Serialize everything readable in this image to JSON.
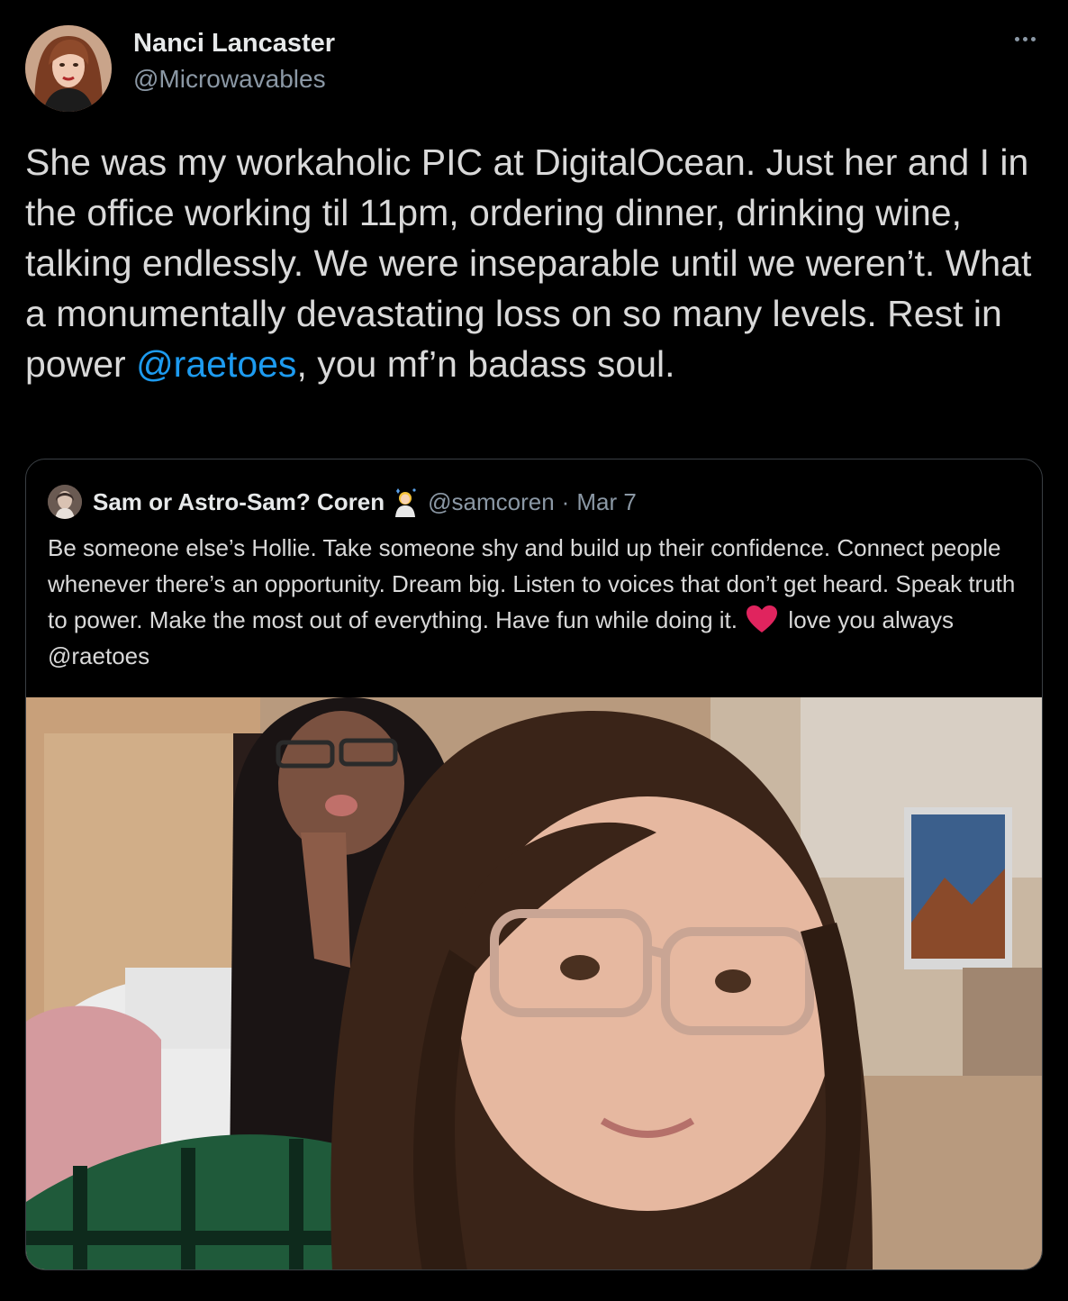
{
  "author": {
    "name": "Nanci Lancaster",
    "handle": "@Microwavables"
  },
  "menu": {
    "icon": "more-horizontal-icon"
  },
  "tweet": {
    "text_before": "She was my workaholic PIC at DigitalOcean. Just her and I in the office working til 11pm, ordering dinner, drinking wine, talking endlessly. We were inseparable until we weren’t. What a monumentally devastating loss on so many levels. Rest in power ",
    "mention": "@raetoes",
    "text_after": ", you mf’n badass soul."
  },
  "quote": {
    "name": "Sam or Astro-Sam? Coren",
    "emoji": "woman-astronaut-emoji",
    "handle": "@samcoren",
    "separator": "·",
    "date": "Mar 7",
    "text_before": "Be someone else’s Hollie. Take someone shy and build up their confidence. Connect people whenever there’s an opportunity. Dream big. Listen to voices that don’t get heard. Speak truth to power. Make the most out of everything. Have fun while doing it. ",
    "heart": "red-heart-emoji",
    "text_after": " love you always @raetoes"
  },
  "colors": {
    "background": "#000000",
    "text": "#d9d9d9",
    "secondary": "#8b98a5",
    "link": "#1d9bf0",
    "border": "#3a3f44",
    "heart": "#e0245e"
  }
}
